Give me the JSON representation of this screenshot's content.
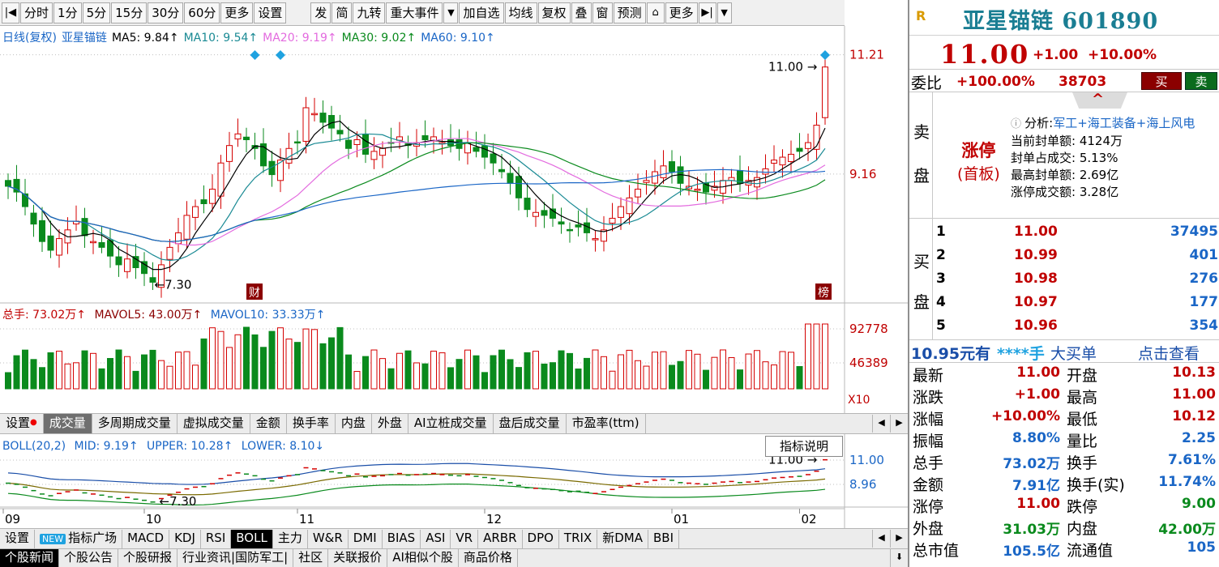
{
  "toolbar": {
    "items": [
      "分时",
      "1分",
      "5分",
      "15分",
      "30分",
      "60分",
      "更多",
      "设置",
      "发",
      "简",
      "九转",
      "重大事件",
      "加自选",
      "均线",
      "复权",
      "叠",
      "窗",
      "预测",
      "更多"
    ],
    "prev_icon": "skip-back-icon",
    "next_icon": "skip-forward-icon"
  },
  "main_chart": {
    "title": "日线(复权)",
    "stock": "亚星锚链",
    "ma": [
      {
        "label": "MA5: 9.84↑",
        "color": "#000000"
      },
      {
        "label": "MA10: 9.54↑",
        "color": "#1a8a94"
      },
      {
        "label": "MA20: 9.19↑",
        "color": "#e36bdf"
      },
      {
        "label": "MA30: 9.02↑",
        "color": "#0a8a1d"
      },
      {
        "label": "MA60: 9.10↑",
        "color": "#1a66c6"
      }
    ],
    "price_ticks": [
      "11.21",
      "9.16"
    ],
    "high_label": "11.00",
    "low_label": "7.30",
    "cai_badge": "财",
    "bang_badge": "榜"
  },
  "volume_chart": {
    "zongshou": "总手: 73.02万↑",
    "mavol5": "MAVOL5: 43.00万↑",
    "mavol10": "MAVOL10: 33.33万↑",
    "ticks": [
      "92778",
      "46389"
    ],
    "unit": "X10"
  },
  "indicator_tabs": [
    "设置",
    "成交量",
    "多周期成交量",
    "虚拟成交量",
    "金额",
    "换手率",
    "内盘",
    "外盘",
    "AI立桩成交量",
    "盘后成交量",
    "市盈率(ttm)"
  ],
  "boll": {
    "name": "BOLL(20,2)",
    "mid": "MID: 9.19↑",
    "upper": "UPPER: 10.28↑",
    "lower": "LOWER: 8.10↓",
    "ticks": [
      "11.00",
      "8.96"
    ],
    "high_label": "11.00",
    "low_label": "7.30",
    "explain_btn": "指标说明"
  },
  "months": [
    "09",
    "10",
    "11",
    "12",
    "01",
    "02"
  ],
  "bottom_tabs1": [
    "设置",
    "指标广场",
    "MACD",
    "KDJ",
    "RSI",
    "BOLL",
    "主力",
    "W&R",
    "DMI",
    "BIAS",
    "ASI",
    "VR",
    "ARBR",
    "DPO",
    "TRIX",
    "新DMA",
    "BBI"
  ],
  "new_badge": "NEW",
  "bottom_tabs2": [
    "个股新闻",
    "个股公告",
    "个股研报",
    "行业资讯|国防军工|",
    "社区",
    "关联报价",
    "AI相似个股",
    "商品价格"
  ],
  "right": {
    "logo": "R",
    "name": "亚星锚链 601890",
    "price": "11.00",
    "change": "+1.00",
    "pct": "+10.00%",
    "weibi_label": "委比",
    "weibi_val": "+100.00%",
    "weibi_num": "38703",
    "buy_btn": "买",
    "sell_btn": "卖",
    "sell_label": [
      "卖",
      "盘"
    ],
    "buy_label": [
      "买",
      "盘"
    ],
    "zt_title": "涨停",
    "zt_sub": "(首板)",
    "analysis_prefix": "分析:",
    "analysis_tags": "军工+海工装备+海上风电",
    "analysis_lines": [
      "当前封单额: 4124万",
      "封单占成交: 5.13%",
      "最高封单额: 2.69亿",
      "涨停成交额: 3.28亿"
    ],
    "orderbook": [
      {
        "lvl": "1",
        "price": "11.00",
        "vol": "37495"
      },
      {
        "lvl": "2",
        "price": "10.99",
        "vol": "401"
      },
      {
        "lvl": "3",
        "price": "10.98",
        "vol": "276"
      },
      {
        "lvl": "4",
        "price": "10.97",
        "vol": "177"
      },
      {
        "lvl": "5",
        "price": "10.96",
        "vol": "354"
      }
    ],
    "big_order": {
      "a": "10.95元有",
      "b": "****手",
      "c": "大买单",
      "d": "点击查看"
    },
    "quotes": [
      {
        "l1": "最新",
        "v1": "11.00",
        "l2": "开盘",
        "v2": "10.13"
      },
      {
        "l1": "涨跌",
        "v1": "+1.00",
        "l2": "最高",
        "v2": "11.00"
      },
      {
        "l1": "涨幅",
        "v1": "+10.00%",
        "l2": "最低",
        "v2": "10.12"
      },
      {
        "l1": "振幅",
        "v1": "8.80%",
        "l2": "量比",
        "v2": "2.25"
      },
      {
        "l1": "总手",
        "v1": "73.02万",
        "l2": "换手",
        "v2": "7.61%"
      },
      {
        "l1": "金额",
        "v1": "7.91亿",
        "l2": "换手(实)",
        "v2": "11.74%"
      },
      {
        "l1": "涨停",
        "v1": "11.00",
        "l2": "跌停",
        "v2": "9.00"
      },
      {
        "l1": "外盘",
        "v1": "31.03万",
        "l2": "内盘",
        "v2": "42.00万"
      },
      {
        "l1": "总市值",
        "v1": "105.5亿",
        "l2": "流通值",
        "v2": "105"
      }
    ]
  },
  "chart_data": {
    "type": "candlestick",
    "close": [
      8.95,
      8.85,
      8.6,
      8.3,
      8.0,
      7.85,
      8.05,
      8.2,
      8.35,
      8.1,
      8.0,
      7.9,
      7.75,
      7.6,
      7.7,
      7.55,
      7.45,
      7.3,
      7.6,
      7.9,
      8.15,
      8.45,
      8.6,
      8.65,
      8.9,
      9.35,
      9.65,
      9.85,
      9.75,
      9.6,
      9.3,
      9.15,
      9.4,
      9.6,
      9.7,
      10.3,
      10.2,
      10.05,
      9.95,
      9.85,
      9.6,
      9.75,
      9.5,
      9.55,
      9.6,
      9.7,
      9.8,
      9.65,
      9.7,
      9.75,
      9.8,
      9.7,
      9.65,
      9.6,
      9.7,
      9.55,
      9.45,
      9.35,
      9.2,
      9.0,
      8.75,
      8.55,
      8.5,
      8.45,
      8.4,
      8.3,
      8.2,
      8.25,
      8.15,
      8.05,
      8.2,
      8.4,
      8.6,
      8.75,
      8.9,
      9.05,
      9.2,
      9.3,
      9.2,
      9.0,
      8.95,
      8.9,
      8.85,
      8.95,
      9.05,
      9.1,
      9.0,
      9.05,
      9.1,
      9.25,
      9.4,
      9.45,
      9.5,
      9.55,
      9.7,
      10.0,
      11.0
    ]
  }
}
